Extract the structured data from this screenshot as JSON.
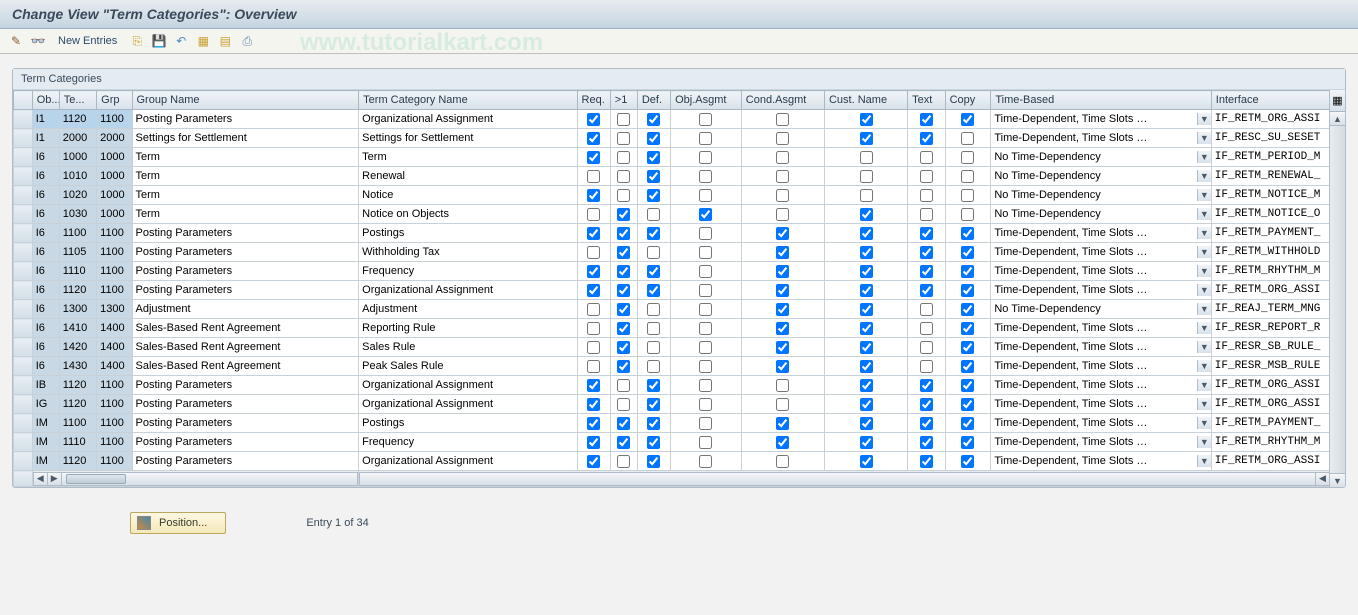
{
  "title": "Change View \"Term Categories\": Overview",
  "toolbar": {
    "new_entries": "New Entries",
    "watermark": "www.tutorialkart.com"
  },
  "panel_title": "Term Categories",
  "columns": {
    "ob": "Ob...",
    "te": "Te...",
    "grp": "Grp",
    "group_name": "Group Name",
    "term_cat_name": "Term Category Name",
    "req": "Req.",
    "gt1": ">1",
    "def": "Def.",
    "obj_asgmt": "Obj.Asgmt",
    "cond_asgmt": "Cond.Asgmt",
    "cust_name": "Cust. Name",
    "text": "Text",
    "copy": "Copy",
    "time_based": "Time-Based",
    "interface": "Interface"
  },
  "time_opts": {
    "slots": "Time-Dependent, Time Slots …",
    "none": "No Time-Dependency"
  },
  "rows": [
    {
      "ob": "I1",
      "te": "1120",
      "grp": "1100",
      "gname": "Posting Parameters",
      "tcname": "Organizational Assignment",
      "req": true,
      "gt1": false,
      "def": true,
      "obja": false,
      "conda": false,
      "cust": true,
      "text": true,
      "copy": true,
      "time": "slots",
      "iface": "IF_RETM_ORG_ASSI",
      "hl": true
    },
    {
      "ob": "I1",
      "te": "2000",
      "grp": "2000",
      "gname": "Settings for Settlement",
      "tcname": "Settings for Settlement",
      "req": true,
      "gt1": false,
      "def": true,
      "obja": false,
      "conda": false,
      "cust": true,
      "text": true,
      "copy": false,
      "time": "slots",
      "iface": "IF_RESC_SU_SESET"
    },
    {
      "ob": "I6",
      "te": "1000",
      "grp": "1000",
      "gname": "Term",
      "tcname": "Term",
      "req": true,
      "gt1": false,
      "def": true,
      "obja": false,
      "conda": false,
      "cust": false,
      "text": false,
      "copy": false,
      "time": "none",
      "iface": "IF_RETM_PERIOD_M"
    },
    {
      "ob": "I6",
      "te": "1010",
      "grp": "1000",
      "gname": "Term",
      "tcname": "Renewal",
      "req": false,
      "gt1": false,
      "def": true,
      "obja": false,
      "conda": false,
      "cust": false,
      "text": false,
      "copy": false,
      "time": "none",
      "iface": "IF_RETM_RENEWAL_"
    },
    {
      "ob": "I6",
      "te": "1020",
      "grp": "1000",
      "gname": "Term",
      "tcname": "Notice",
      "req": true,
      "gt1": false,
      "def": true,
      "obja": false,
      "conda": false,
      "cust": false,
      "text": false,
      "copy": false,
      "time": "none",
      "iface": "IF_RETM_NOTICE_M"
    },
    {
      "ob": "I6",
      "te": "1030",
      "grp": "1000",
      "gname": "Term",
      "tcname": "Notice on Objects",
      "req": false,
      "gt1": true,
      "def": false,
      "obja": true,
      "conda": false,
      "cust": true,
      "text": false,
      "copy": false,
      "time": "none",
      "iface": "IF_RETM_NOTICE_O"
    },
    {
      "ob": "I6",
      "te": "1100",
      "grp": "1100",
      "gname": "Posting Parameters",
      "tcname": "Postings",
      "req": true,
      "gt1": true,
      "def": true,
      "obja": false,
      "conda": true,
      "cust": true,
      "text": true,
      "copy": true,
      "time": "slots",
      "iface": "IF_RETM_PAYMENT_"
    },
    {
      "ob": "I6",
      "te": "1105",
      "grp": "1100",
      "gname": "Posting Parameters",
      "tcname": "Withholding Tax",
      "req": false,
      "gt1": true,
      "def": false,
      "obja": false,
      "conda": true,
      "cust": true,
      "text": true,
      "copy": true,
      "time": "slots",
      "iface": "IF_RETM_WITHHOLD"
    },
    {
      "ob": "I6",
      "te": "1110",
      "grp": "1100",
      "gname": "Posting Parameters",
      "tcname": "Frequency",
      "req": true,
      "gt1": true,
      "def": true,
      "obja": false,
      "conda": true,
      "cust": true,
      "text": true,
      "copy": true,
      "time": "slots",
      "iface": "IF_RETM_RHYTHM_M"
    },
    {
      "ob": "I6",
      "te": "1120",
      "grp": "1100",
      "gname": "Posting Parameters",
      "tcname": "Organizational Assignment",
      "req": true,
      "gt1": true,
      "def": true,
      "obja": false,
      "conda": true,
      "cust": true,
      "text": true,
      "copy": true,
      "time": "slots",
      "iface": "IF_RETM_ORG_ASSI"
    },
    {
      "ob": "I6",
      "te": "1300",
      "grp": "1300",
      "gname": "Adjustment",
      "tcname": "Adjustment",
      "req": false,
      "gt1": true,
      "def": false,
      "obja": false,
      "conda": true,
      "cust": true,
      "text": false,
      "copy": true,
      "time": "none",
      "iface": "IF_REAJ_TERM_MNG"
    },
    {
      "ob": "I6",
      "te": "1410",
      "grp": "1400",
      "gname": "Sales-Based Rent Agreement",
      "tcname": "Reporting Rule",
      "req": false,
      "gt1": true,
      "def": false,
      "obja": false,
      "conda": true,
      "cust": true,
      "text": false,
      "copy": true,
      "time": "slots",
      "iface": "IF_RESR_REPORT_R"
    },
    {
      "ob": "I6",
      "te": "1420",
      "grp": "1400",
      "gname": "Sales-Based Rent Agreement",
      "tcname": "Sales Rule",
      "req": false,
      "gt1": true,
      "def": false,
      "obja": false,
      "conda": true,
      "cust": true,
      "text": false,
      "copy": true,
      "time": "slots",
      "iface": "IF_RESR_SB_RULE_"
    },
    {
      "ob": "I6",
      "te": "1430",
      "grp": "1400",
      "gname": "Sales-Based Rent Agreement",
      "tcname": "Peak Sales Rule",
      "req": false,
      "gt1": true,
      "def": false,
      "obja": false,
      "conda": true,
      "cust": true,
      "text": false,
      "copy": true,
      "time": "slots",
      "iface": "IF_RESR_MSB_RULE"
    },
    {
      "ob": "IB",
      "te": "1120",
      "grp": "1100",
      "gname": "Posting Parameters",
      "tcname": "Organizational Assignment",
      "req": true,
      "gt1": false,
      "def": true,
      "obja": false,
      "conda": false,
      "cust": true,
      "text": true,
      "copy": true,
      "time": "slots",
      "iface": "IF_RETM_ORG_ASSI"
    },
    {
      "ob": "IG",
      "te": "1120",
      "grp": "1100",
      "gname": "Posting Parameters",
      "tcname": "Organizational Assignment",
      "req": true,
      "gt1": false,
      "def": true,
      "obja": false,
      "conda": false,
      "cust": true,
      "text": true,
      "copy": true,
      "time": "slots",
      "iface": "IF_RETM_ORG_ASSI"
    },
    {
      "ob": "IM",
      "te": "1100",
      "grp": "1100",
      "gname": "Posting Parameters",
      "tcname": "Postings",
      "req": true,
      "gt1": true,
      "def": true,
      "obja": false,
      "conda": true,
      "cust": true,
      "text": true,
      "copy": true,
      "time": "slots",
      "iface": "IF_RETM_PAYMENT_"
    },
    {
      "ob": "IM",
      "te": "1110",
      "grp": "1100",
      "gname": "Posting Parameters",
      "tcname": "Frequency",
      "req": true,
      "gt1": true,
      "def": true,
      "obja": false,
      "conda": true,
      "cust": true,
      "text": true,
      "copy": true,
      "time": "slots",
      "iface": "IF_RETM_RHYTHM_M"
    },
    {
      "ob": "IM",
      "te": "1120",
      "grp": "1100",
      "gname": "Posting Parameters",
      "tcname": "Organizational Assignment",
      "req": true,
      "gt1": false,
      "def": true,
      "obja": false,
      "conda": false,
      "cust": true,
      "text": true,
      "copy": true,
      "time": "slots",
      "iface": "IF_RETM_ORG_ASSI"
    }
  ],
  "footer": {
    "position_btn": "Position...",
    "entry_text": "Entry 1 of 34"
  }
}
